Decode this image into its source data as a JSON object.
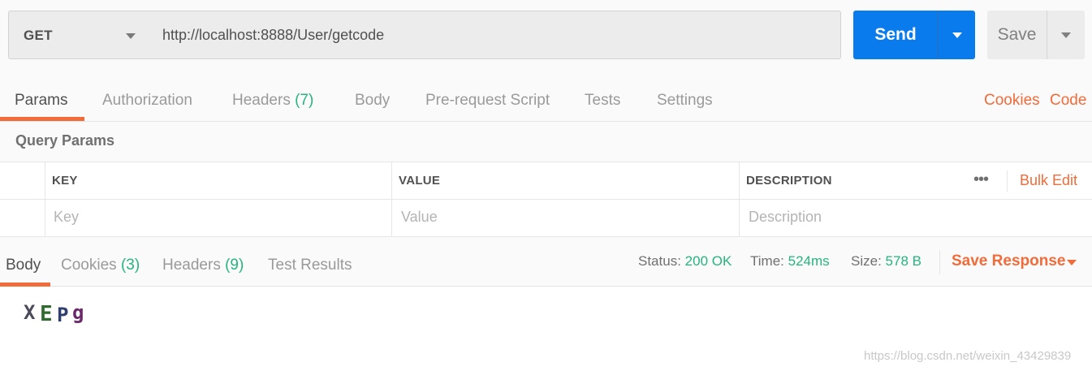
{
  "request": {
    "method": "GET",
    "url": "http://localhost:8888/User/getcode",
    "send_label": "Send",
    "save_label": "Save"
  },
  "request_tabs": [
    {
      "label": "Params",
      "count": ""
    },
    {
      "label": "Authorization",
      "count": ""
    },
    {
      "label": "Headers",
      "count": "(7)"
    },
    {
      "label": "Body",
      "count": ""
    },
    {
      "label": "Pre-request Script",
      "count": ""
    },
    {
      "label": "Tests",
      "count": ""
    },
    {
      "label": "Settings",
      "count": ""
    }
  ],
  "request_links": {
    "cookies": "Cookies",
    "code": "Code"
  },
  "query_params": {
    "title": "Query Params",
    "headers": {
      "key": "KEY",
      "value": "VALUE",
      "description": "DESCRIPTION"
    },
    "more": "•••",
    "bulk_edit": "Bulk Edit",
    "placeholders": {
      "key": "Key",
      "value": "Value",
      "description": "Description"
    }
  },
  "response_tabs": [
    {
      "label": "Body",
      "count": ""
    },
    {
      "label": "Cookies",
      "count": "(3)"
    },
    {
      "label": "Headers",
      "count": "(9)"
    },
    {
      "label": "Test Results",
      "count": ""
    }
  ],
  "response_meta": {
    "status_label": "Status:",
    "status_value": "200 OK",
    "time_label": "Time:",
    "time_value": "524ms",
    "size_label": "Size:",
    "size_value": "578 B",
    "save_response": "Save Response"
  },
  "response_body": {
    "captcha_text": "XEPg",
    "captcha_chars": [
      {
        "char": "X",
        "color": "#4a4a5a"
      },
      {
        "char": "E",
        "color": "#2f6b2f"
      },
      {
        "char": "P",
        "color": "#2e3f6e"
      },
      {
        "char": "g",
        "color": "#6a2a6a"
      }
    ]
  },
  "watermark": "https://blog.csdn.net/weixin_43429839",
  "colors": {
    "accent": "#f26b3a",
    "send": "#097bed",
    "success": "#26b47f"
  }
}
